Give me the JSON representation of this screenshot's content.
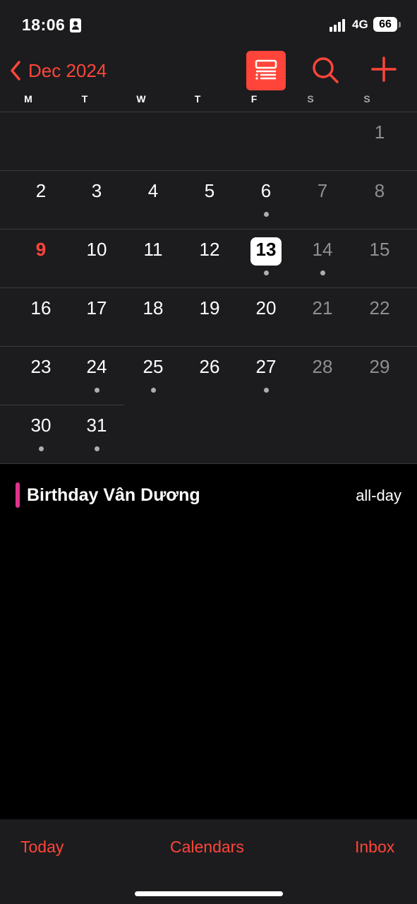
{
  "status_bar": {
    "time": "18:06",
    "network": "4G",
    "battery": "66"
  },
  "nav": {
    "back_label": "Dec 2024",
    "icons": [
      "chevron-left-icon",
      "list-view-icon",
      "search-icon",
      "plus-icon"
    ],
    "accent_color": "#ff453a"
  },
  "weekdays": [
    "M",
    "T",
    "W",
    "T",
    "F",
    "S",
    "S"
  ],
  "month": {
    "weeks": [
      [
        "",
        "",
        "",
        "",
        "",
        "",
        "1"
      ],
      [
        "2",
        "3",
        "4",
        "5",
        "6",
        "7",
        "8"
      ],
      [
        "9",
        "10",
        "11",
        "12",
        "13",
        "14",
        "15"
      ],
      [
        "16",
        "17",
        "18",
        "19",
        "20",
        "21",
        "22"
      ],
      [
        "23",
        "24",
        "25",
        "26",
        "27",
        "28",
        "29"
      ],
      [
        "30",
        "31",
        "",
        "",
        "",
        "",
        ""
      ]
    ],
    "today": "9",
    "selected": "13",
    "days_with_events": [
      "6",
      "13",
      "14",
      "24",
      "25",
      "27",
      "30",
      "31"
    ]
  },
  "events": [
    {
      "title": "Birthday Vân Dương",
      "time": "all-day",
      "color": "#e0338c"
    }
  ],
  "toolbar": {
    "today_label": "Today",
    "calendars_label": "Calendars",
    "inbox_label": "Inbox"
  }
}
